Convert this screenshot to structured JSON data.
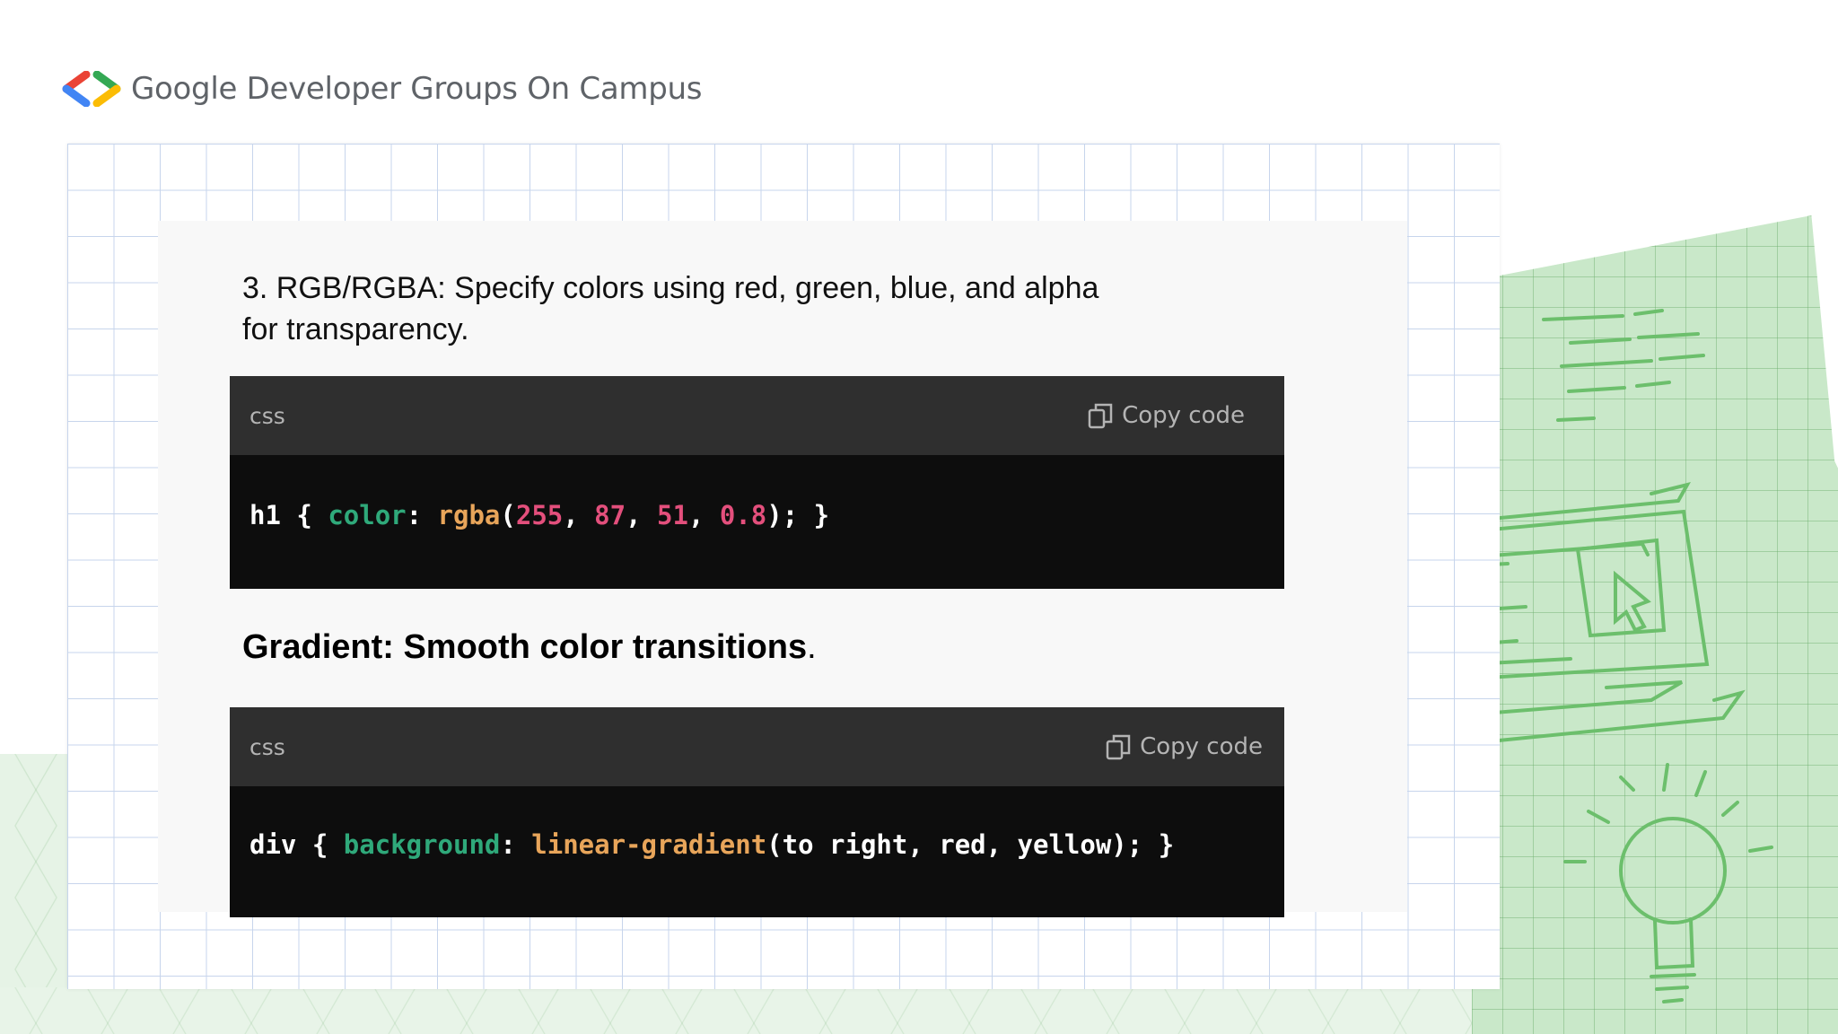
{
  "header": {
    "brand": "Google Developer Groups On Campus",
    "logo_colors": [
      "#4285F4",
      "#EA4335",
      "#34A853",
      "#FBBC04"
    ]
  },
  "content": {
    "paragraph": "3. RGB/RGBA: Specify colors using red, green, blue, and alpha for transparency.",
    "heading": "Gradient: Smooth color transitions",
    "heading_dot": "."
  },
  "code_blocks": [
    {
      "language": "css",
      "copy_label": "Copy code",
      "tokens": {
        "selector": "h1 { ",
        "prop": "color",
        "colon": ": ",
        "func": "rgba",
        "open": "(",
        "n1": "255",
        "c1": ", ",
        "n2": "87",
        "c2": ", ",
        "n3": "51",
        "c3": ", ",
        "n4": "0.8",
        "close": "); }"
      }
    },
    {
      "language": "css",
      "copy_label": "Copy code",
      "tokens": {
        "selector": "div { ",
        "prop": "background",
        "colon": ": ",
        "func": "linear-gradient",
        "args": "(to right, red, yellow); }"
      }
    }
  ],
  "colors": {
    "code_bg": "#0d0d0d",
    "code_header_bg": "#2f2f2f",
    "property": "#2fa97a",
    "function": "#e8a55a",
    "number": "#e34f7c",
    "grid_line": "#c7d5ec",
    "sketch_green": "#c9e8c9"
  }
}
